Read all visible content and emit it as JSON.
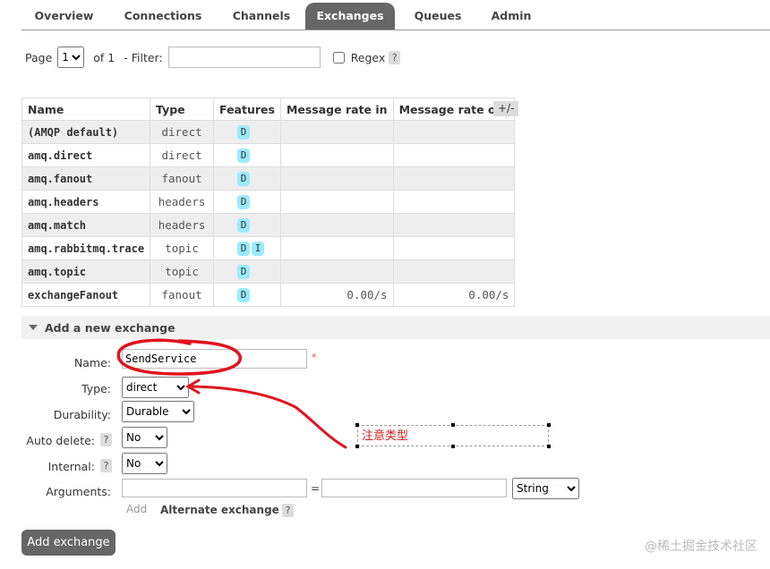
{
  "tabs": [
    "Overview",
    "Connections",
    "Channels",
    "Exchanges",
    "Queues",
    "Admin"
  ],
  "active_tab": "Exchanges",
  "paging": {
    "page_label": "Page",
    "page_value": "1",
    "of_label": "of 1",
    "filter_label": "- Filter:",
    "regex_label": "Regex",
    "help": "?"
  },
  "table": {
    "headers": [
      "Name",
      "Type",
      "Features",
      "Message rate in",
      "Message rate out"
    ],
    "toggle": "+/-",
    "rows": [
      {
        "name": "(AMQP default)",
        "type": "direct",
        "features": [
          "D"
        ],
        "rate_in": "",
        "rate_out": ""
      },
      {
        "name": "amq.direct",
        "type": "direct",
        "features": [
          "D"
        ],
        "rate_in": "",
        "rate_out": ""
      },
      {
        "name": "amq.fanout",
        "type": "fanout",
        "features": [
          "D"
        ],
        "rate_in": "",
        "rate_out": ""
      },
      {
        "name": "amq.headers",
        "type": "headers",
        "features": [
          "D"
        ],
        "rate_in": "",
        "rate_out": ""
      },
      {
        "name": "amq.match",
        "type": "headers",
        "features": [
          "D"
        ],
        "rate_in": "",
        "rate_out": ""
      },
      {
        "name": "amq.rabbitmq.trace",
        "type": "topic",
        "features": [
          "D",
          "I"
        ],
        "rate_in": "",
        "rate_out": ""
      },
      {
        "name": "amq.topic",
        "type": "topic",
        "features": [
          "D"
        ],
        "rate_in": "",
        "rate_out": ""
      },
      {
        "name": "exchangeFanout",
        "type": "fanout",
        "features": [
          "D"
        ],
        "rate_in": "0.00/s",
        "rate_out": "0.00/s"
      }
    ]
  },
  "add_section": {
    "title": "Add a new exchange",
    "name_label": "Name:",
    "name_value": "SendService",
    "required": "*",
    "type_label": "Type:",
    "type_value": "direct",
    "durability_label": "Durability:",
    "durability_value": "Durable",
    "auto_delete_label": "Auto delete:",
    "auto_delete_value": "No",
    "internal_label": "Internal:",
    "internal_value": "No",
    "arguments_label": "Arguments:",
    "eq": "=",
    "arg_type_value": "String",
    "add_link": "Add",
    "alternate_label": "Alternate exchange",
    "help": "?"
  },
  "annotation_note": "注意类型",
  "submit_label": "Add exchange",
  "watermark": "@稀土掘金技术社区",
  "colors": {
    "annotation_red": "#e0141e",
    "tab_active": "#666666",
    "feature_badge": "#99ebff"
  }
}
